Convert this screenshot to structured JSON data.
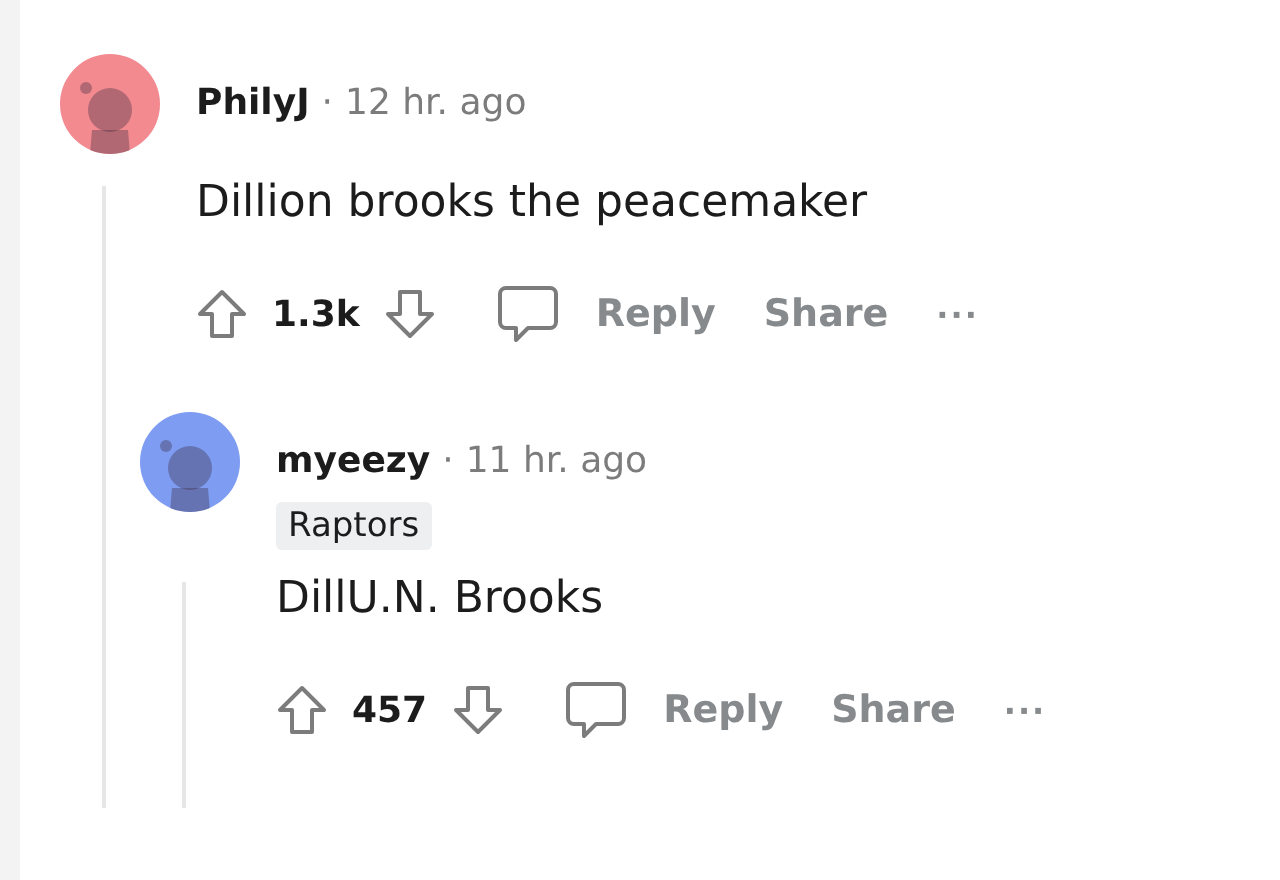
{
  "comments": [
    {
      "author": "PhilyJ",
      "separator": "·",
      "time": "12 hr. ago",
      "color": "#f28a90",
      "body": "Dillion brooks the peacemaker",
      "score": "1.3k",
      "actions": [
        "Reply",
        "Share"
      ],
      "more": "···",
      "children": [
        {
          "author": "myeezy",
          "separator": "·",
          "time": "11 hr. ago",
          "color": "#7d9cf2",
          "flair": "Raptors",
          "body": "DillU.N. Brooks",
          "score": "457",
          "actions": [
            "Reply",
            "Share"
          ],
          "more": "···"
        }
      ]
    }
  ]
}
